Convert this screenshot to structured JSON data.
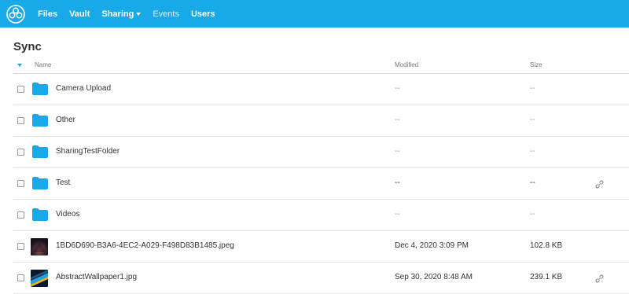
{
  "nav": {
    "items": [
      {
        "label": "Files"
      },
      {
        "label": "Vault"
      },
      {
        "label": "Sharing"
      },
      {
        "label": "Events"
      },
      {
        "label": "Users"
      }
    ]
  },
  "page": {
    "title": "Sync"
  },
  "table": {
    "columns": {
      "name": "Name",
      "modified": "Modified",
      "size": "Size"
    },
    "rows": [
      {
        "name": "Camera Upload",
        "modified": "--",
        "size": "--",
        "type": "folder",
        "shared": false
      },
      {
        "name": "Other",
        "modified": "--",
        "size": "--",
        "type": "folder",
        "shared": false
      },
      {
        "name": "SharingTestFolder",
        "modified": "--",
        "size": "--",
        "type": "folder",
        "shared": false
      },
      {
        "name": "Test",
        "modified": "--",
        "size": "--",
        "type": "folder",
        "shared": true
      },
      {
        "name": "Videos",
        "modified": "--",
        "size": "--",
        "type": "folder",
        "shared": false
      },
      {
        "name": "1BD6D690-B3A6-4EC2-A029-F498D83B1485.jpeg",
        "modified": "Dec 4, 2020 3:09 PM",
        "size": "102.8 KB",
        "type": "image",
        "shared": false
      },
      {
        "name": "AbstractWallpaper1.jpg",
        "modified": "Sep 30, 2020 8:48 AM",
        "size": "239.1 KB",
        "type": "image",
        "shared": true
      }
    ]
  },
  "colors": {
    "accent": "#17a9e8",
    "folder": "#17a9e8"
  }
}
